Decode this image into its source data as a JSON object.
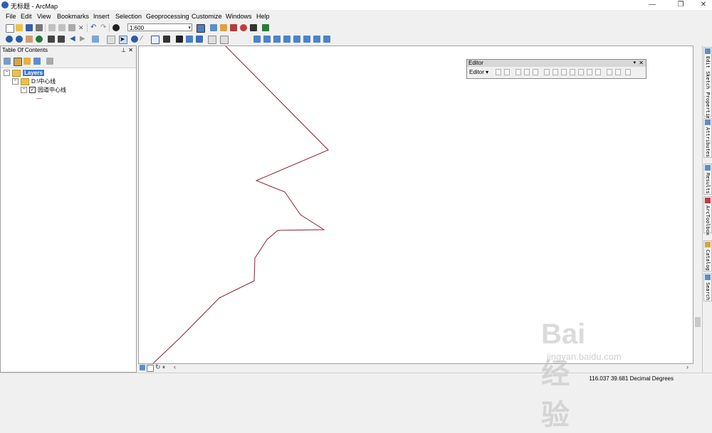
{
  "window": {
    "title": "无标题 - ArcMap"
  },
  "menu": [
    "File",
    "Edit",
    "View",
    "Bookmarks",
    "Insert",
    "Selection",
    "Geoprocessing",
    "Customize",
    "Windows",
    "Help"
  ],
  "toolbar": {
    "scale_value": "1:600"
  },
  "toc": {
    "title": "Table Of Contents",
    "layers_label": "Layers",
    "folder_label": "D:\\中心线",
    "layer_label": "园道中心线",
    "legend_symbol": "—"
  },
  "editor": {
    "title": "Editor",
    "menu_label": "Editor ▾"
  },
  "right_dock": [
    "Edit Sketch Properties",
    "Attributes",
    "Results",
    "ArcToolbox",
    "Catalog",
    "Search"
  ],
  "status": {
    "coordinates": "116.037  39.681 Decimal Degrees"
  },
  "watermark": {
    "text": "Bai经验",
    "url": "jingyan.baidu.com"
  },
  "colors": {
    "line": "#8b2130",
    "selection": "#3a78d8"
  },
  "icons": {
    "toc": [
      "list-by-drawing-order-icon",
      "list-by-source-icon",
      "list-by-visibility-icon",
      "list-by-selection-icon",
      "options-icon"
    ]
  }
}
